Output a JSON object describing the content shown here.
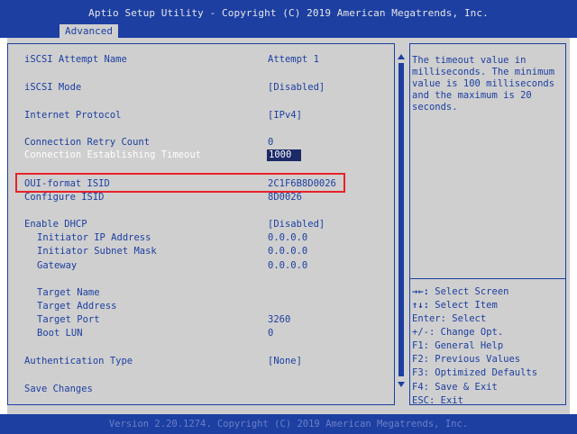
{
  "header": {
    "title": "Aptio Setup Utility - Copyright (C) 2019 American Megatrends, Inc.",
    "tab": "Advanced"
  },
  "settings": {
    "iscsi_attempt_name": {
      "label": "iSCSI Attempt Name",
      "value": "Attempt 1"
    },
    "iscsi_mode": {
      "label": "iSCSI Mode",
      "value": "[Disabled]"
    },
    "internet_protocol": {
      "label": "Internet Protocol",
      "value": "[IPv4]"
    },
    "connection_retry_count": {
      "label": "Connection Retry Count",
      "value": "0"
    },
    "connection_timeout": {
      "label": "Connection Establishing Timeout",
      "value": "1000"
    },
    "oui_format_isid": {
      "label": "OUI-format ISID",
      "value": "2C1F6B8D0026"
    },
    "configure_isid": {
      "label": "Configure ISID",
      "value": "8D0026"
    },
    "enable_dhcp": {
      "label": "Enable DHCP",
      "value": "[Disabled]"
    },
    "initiator_ip": {
      "label": "Initiator IP Address",
      "value": "0.0.0.0"
    },
    "initiator_subnet": {
      "label": "Initiator Subnet Mask",
      "value": "0.0.0.0"
    },
    "gateway": {
      "label": "Gateway",
      "value": "0.0.0.0"
    },
    "target_name": {
      "label": "Target Name",
      "value": ""
    },
    "target_address": {
      "label": "Target Address",
      "value": ""
    },
    "target_port": {
      "label": "Target Port",
      "value": "3260"
    },
    "boot_lun": {
      "label": "Boot LUN",
      "value": "0"
    },
    "authentication_type": {
      "label": "Authentication Type",
      "value": "[None]"
    },
    "save_changes": {
      "label": "Save Changes",
      "value": ""
    }
  },
  "help_text": "The timeout value in\nmilliseconds. The minimum\nvalue is 100 milliseconds\nand the maximum is 20\nseconds.",
  "key_help": [
    {
      "key": "→←:",
      "desc": " Select Screen"
    },
    {
      "key": "↑↓:",
      "desc": " Select Item"
    },
    {
      "key": "Enter:",
      "desc": " Select"
    },
    {
      "key": "+/-:",
      "desc": " Change Opt."
    },
    {
      "key": "F1:",
      "desc": " General Help"
    },
    {
      "key": "F2:",
      "desc": " Previous Values"
    },
    {
      "key": "F3:",
      "desc": " Optimized Defaults"
    },
    {
      "key": "F4:",
      "desc": " Save & Exit"
    },
    {
      "key": "ESC:",
      "desc": " Exit"
    }
  ],
  "footer": "Version 2.20.1274. Copyright (C) 2019 American Megatrends, Inc.",
  "colors": {
    "bios_blue": "#1c3fa1",
    "panel_gray": "#cfcfcf",
    "selected_value_bg": "#1c2a68",
    "annotation_red": "#e8222a"
  }
}
